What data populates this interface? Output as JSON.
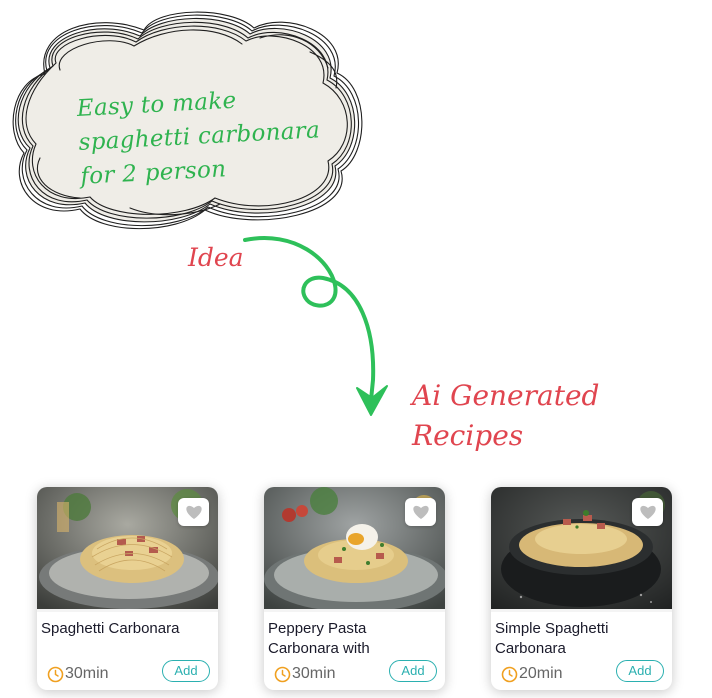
{
  "idea_cloud": {
    "lines": [
      "Easy to make",
      "spaghetti carbonara",
      "for 2 person"
    ]
  },
  "idea_label": "Idea",
  "generated_label": {
    "line1": "Ai Generated",
    "line2": "Recipes"
  },
  "colors": {
    "cloud_text": "#2fb34f",
    "labels": "#e0454f",
    "arrow": "#2ec05a",
    "accent": "#2bb0b0",
    "clock": "#f0a020"
  },
  "recipes": [
    {
      "title": "Spaghetti Carbonara",
      "time": "30min",
      "add_label": "Add",
      "favorite_icon": "heart-icon"
    },
    {
      "title": "Peppery Pasta Carbonara with",
      "time": "30min",
      "add_label": "Add",
      "favorite_icon": "heart-icon"
    },
    {
      "title": "Simple Spaghetti Carbonara",
      "time": "20min",
      "add_label": "Add",
      "favorite_icon": "heart-icon"
    }
  ]
}
